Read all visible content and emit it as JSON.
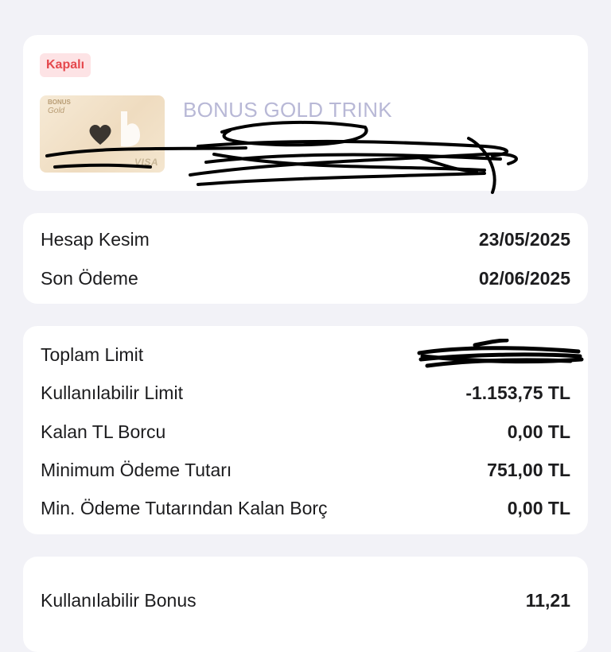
{
  "account": {
    "status_badge": "Kapalı",
    "card_name": "BONUS GOLD TRINK",
    "thumb": {
      "brand": "BONUS",
      "gold": "Gold",
      "network": "VISA"
    }
  },
  "dates": {
    "statement_label": "Hesap Kesim",
    "statement_value": "23/05/2025",
    "due_label": "Son Ödeme",
    "due_value": "02/06/2025"
  },
  "limits": {
    "total_label": "Toplam Limit",
    "available_label": "Kullanılabilir Limit",
    "available_value": "-1.153,75 TL",
    "remaining_debt_label": "Kalan TL Borcu",
    "remaining_debt_value": "0,00 TL",
    "min_payment_label": "Minimum Ödeme Tutarı",
    "min_payment_value": "751,00 TL",
    "min_remaining_label": "Min. Ödeme Tutarından Kalan Borç",
    "min_remaining_value": "0,00 TL"
  },
  "bonus": {
    "available_label": "Kullanılabilir Bonus",
    "available_value": "11,21"
  }
}
